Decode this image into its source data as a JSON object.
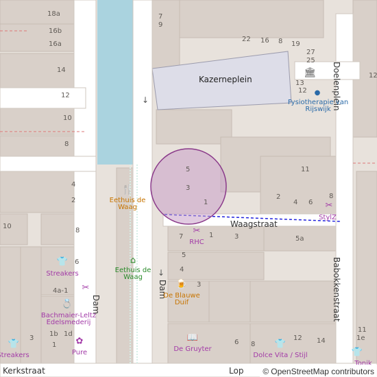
{
  "map": {
    "streets": {
      "kazerneplein": "Kazerneplein",
      "waagstraat": "Waagstraat",
      "dam_left": "Dam",
      "dam_right": "Dam",
      "doelenplein": "Doelenplein",
      "babokkenstraat": "Babokkenstraat",
      "kerkstraat": "Kerkstraat",
      "lop": "Lop"
    },
    "house_numbers": {
      "n18a": "18a",
      "n16b": "16b",
      "n16a": "16a",
      "n14": "14",
      "n12": "12",
      "n10": "10",
      "n8l": "8",
      "n4l": "4",
      "n2l": "2",
      "n10l": "10",
      "n8b": "8",
      "n6l": "6",
      "n4a1": "4a-1",
      "n3l": "3",
      "n1b": "1b",
      "n1d": "1d",
      "n1": "1",
      "n7": "7",
      "n9": "9",
      "n22": "22",
      "n16": "16",
      "n8t": "8",
      "n19": "19",
      "n27": "27",
      "n25": "25",
      "n13": "13",
      "n12b": "12",
      "n12r": "12",
      "n5": "5",
      "n3": "3",
      "n1c": "1",
      "n11": "11",
      "n2r": "2",
      "n4r": "4",
      "n6r": "6",
      "n8r": "8",
      "n7w": "7",
      "n1w": "1",
      "n3w": "3",
      "n5a": "5a",
      "n5d": "5",
      "n4d": "4",
      "n3d": "3",
      "n6b": "6",
      "n8bb": "8",
      "n12bb": "12",
      "n14b": "14",
      "n1e": "1e",
      "n11b": "11"
    },
    "pois": {
      "eethuis_food": "Eethuis de Waag",
      "eethuis_park": "Eethuis de Waag",
      "streakers_top": "Streakers",
      "bachmaier": "Bachmaier-Leltz Edelsmederij",
      "streakers_bottom": "Streakers",
      "pure": "Pure",
      "rhc": "RHC",
      "blauwe_duif": "De Blauwe Duif",
      "gruyter": "De Gruyter",
      "fysio": "Fysiotherapie van Rijswijk",
      "stylz": "StylZ",
      "dolce_vita": "Dolce Vita / Stijl",
      "tonik": "Tonik"
    },
    "colors": {
      "building": "#d9d0c9",
      "road": "#ffffff",
      "water": "#aad3df",
      "square": "#dddde8",
      "boundary": "#1e1edc",
      "shop": "#a23aa7",
      "food": "#c77400",
      "green": "#2a8a2a"
    },
    "icons": {
      "food": "fork-knife-icon",
      "park": "shelter-icon",
      "clothes": "tshirt-icon",
      "hairdresser": "scissors-icon",
      "jewelry": "ring-icon",
      "florist": "flower-icon",
      "bar": "glass-icon",
      "books": "book-icon",
      "museum": "museum-icon",
      "health": "dot-icon"
    }
  },
  "attribution": {
    "symbol": "©",
    "text": "OpenStreetMap contributors"
  }
}
